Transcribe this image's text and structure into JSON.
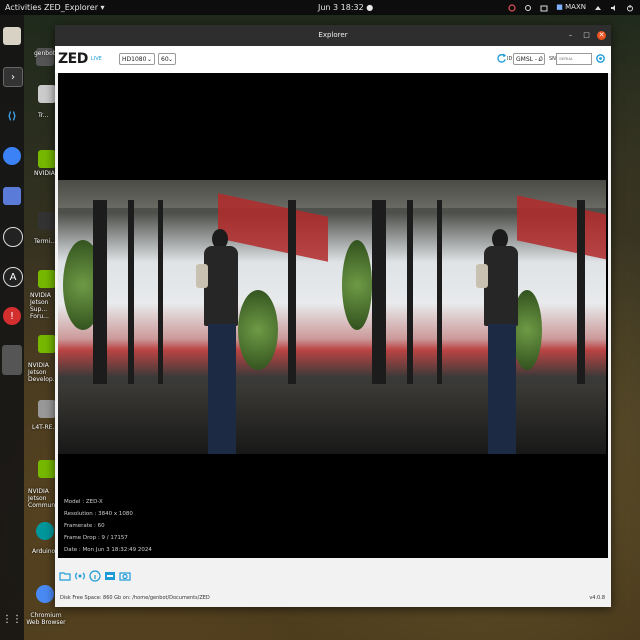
{
  "topbar": {
    "activities": "Activities",
    "app_menu": "ZED_Explorer",
    "clock": "Jun 3  18:32",
    "power_mode": "MAXN"
  },
  "dock": {
    "icons": [
      "files-icon",
      "terminal-icon",
      "vscode-icon",
      "chromium-icon",
      "screenshot-icon",
      "obs-icon",
      "ubuntu-software-icon",
      "help-icon",
      "app-grid-icon"
    ]
  },
  "desktop": {
    "items": [
      {
        "label": "genbot"
      },
      {
        "label": "Tr..."
      },
      {
        "label": "NVIDIA Jetson..."
      },
      {
        "label": "Termi..."
      },
      {
        "label": "NVIDIA Jetson Sup... Foru..."
      },
      {
        "label": "NVIDIA Jetson Develop..."
      },
      {
        "label": "L4T-RE..."
      },
      {
        "label": "NVIDIA Jetson Commun..."
      },
      {
        "label": "Arduino ID..."
      },
      {
        "label": "Chromium Web Browser"
      }
    ]
  },
  "window": {
    "title": "Explorer"
  },
  "toolbar": {
    "logo": "ZED",
    "live_label": "LIVE",
    "resolution": "HD1080",
    "fps": "60",
    "id_label": "ID",
    "camera": "GMSL - 0",
    "sn_label": "SN",
    "sn_placeholder": "SERIAL"
  },
  "info": {
    "model": "Model : ZED-X",
    "resolution": "Resolution : 3840 x 1080",
    "framerate": "Framerate : 60",
    "frame_drop": "Frame Drop : 9 / 17157",
    "date": "Date : Mon Jun 3 18:32:49 2024"
  },
  "footer": {
    "status": "Disk Free Space: 860 Gb  on: /home/genbot/Documents/ZED",
    "version": "v4.0.8"
  },
  "colors": {
    "accent": "#1e9bd7",
    "close": "#e95420"
  }
}
